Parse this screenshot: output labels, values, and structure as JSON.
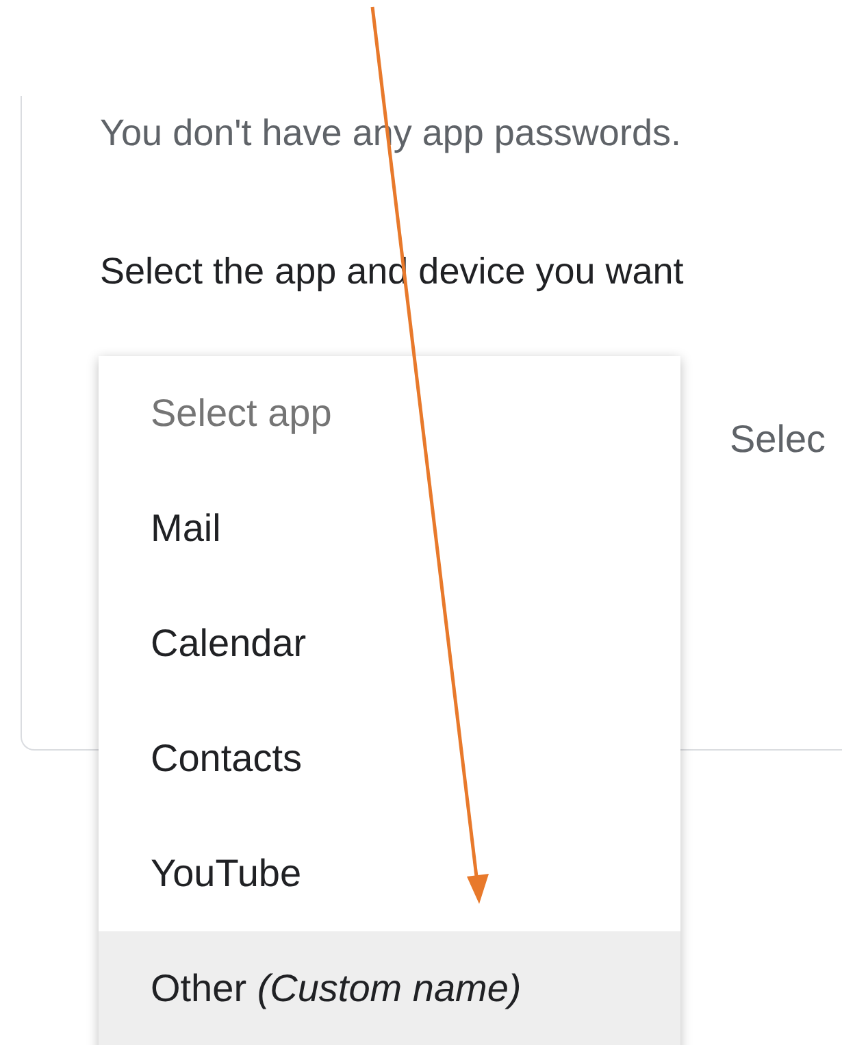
{
  "status_message": "You don't have any app passwords.",
  "instruction": "Select the app and device you want",
  "device_select": {
    "placeholder": "Selec"
  },
  "app_menu": {
    "items": [
      {
        "kind": "placeholder",
        "label": "Select app",
        "selected": false
      },
      {
        "kind": "option",
        "label": "Mail",
        "selected": false
      },
      {
        "kind": "option",
        "label": "Calendar",
        "selected": false
      },
      {
        "kind": "option",
        "label": "Contacts",
        "selected": false
      },
      {
        "kind": "option",
        "label": "YouTube",
        "selected": false
      },
      {
        "kind": "option",
        "label": "Other *(Custom name)*",
        "selected": true
      }
    ]
  }
}
